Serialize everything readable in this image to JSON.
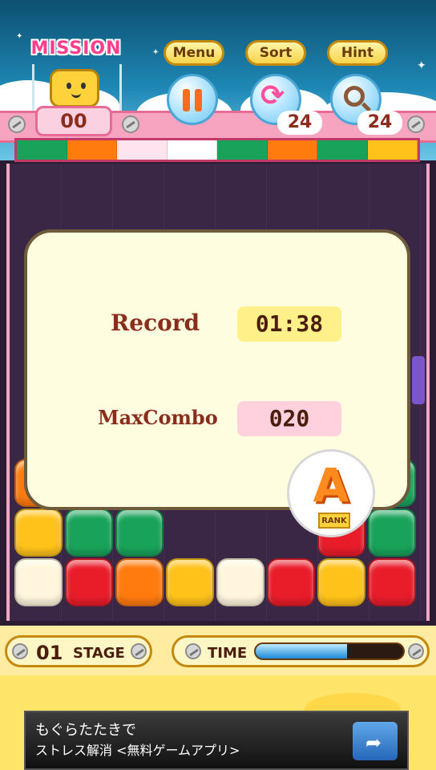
{
  "header": {
    "mission_label": "MISSION",
    "mission_count": "00",
    "buttons": {
      "menu": "Menu",
      "sort": "Sort",
      "hint": "Hint"
    },
    "sort_count": "24",
    "hint_count": "24"
  },
  "progress_strip": {
    "colors": [
      "#19a35a",
      "#ff7b0e",
      "#ffe4ef",
      "#ffffff",
      "#19a35a",
      "#ff7b0e",
      "#19a35a",
      "#ffc21a"
    ]
  },
  "result": {
    "record_label": "Record",
    "record_value": "01:38",
    "combo_label": "MaxCombo",
    "combo_value": "020",
    "rank_letter": "A",
    "rank_label": "RANK"
  },
  "board": {
    "row1": [
      "orange",
      "",
      "",
      "",
      "",
      "",
      "",
      "green"
    ],
    "row2": [
      "yellow",
      "green",
      "green",
      "",
      "",
      "",
      "red",
      "green"
    ],
    "row3": [
      "cream",
      "red",
      "orange",
      "yellow",
      "cream",
      "red",
      "yellow",
      "red"
    ]
  },
  "hud": {
    "stage_number": "01",
    "stage_label": "STAGE",
    "time_label": "TIME",
    "time_fraction": 0.62
  },
  "ad": {
    "line1": "もぐらたたきで",
    "line2": "ストレス解消 <無料ゲームアプリ>",
    "button_icon": "share-arrow-icon"
  },
  "colors": {
    "pink_accent": "#ff3d8a",
    "text_brown": "#8b2d1d",
    "panel_bg": "#fffde0"
  }
}
